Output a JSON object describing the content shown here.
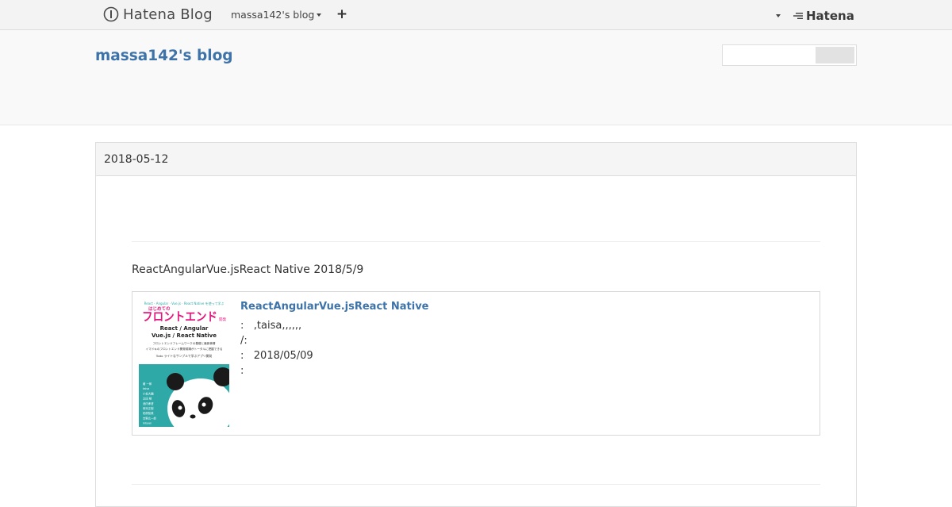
{
  "global_header": {
    "logo_text": "Hatena Blog",
    "blog_menu_label": "massa142's blog",
    "add_button_label": "+",
    "hatena_logo_text": "Hatena"
  },
  "blog_header": {
    "title": "massa142's blog",
    "search": {
      "value": "",
      "placeholder": "",
      "button_label": ""
    }
  },
  "entry": {
    "date": "2018-05-12",
    "text": "ReactAngularVue.jsReact Native 2018/5/9",
    "book": {
      "title": "ReactAngularVue.jsReact Native",
      "author_line": ":   ,taisa,,,,,,",
      "publisher_line": "/:",
      "date_line": ":   2018/05/09",
      "media_line": ":",
      "cover": {
        "top_caption": "React · Angular · Vue.js · React Native を使って学ぶ",
        "small_title": "はじめての",
        "big_title": "フロントエンド",
        "big_title_suffix": "開発",
        "subtitle_line1": "React / Angular",
        "subtitle_line2": "Vue.js / React Native",
        "desc_line1": "フロントエンドフレームワークの基礎と最新事情",
        "desc_line2": "イマドキのフロントエンド開発現場がトータルに把握できる",
        "desc_line3": "Todo ライトなサンプルで学ぶアプリ開発",
        "authors": [
          "著 一郎",
          "taisa",
          "小松大輔",
          "太田 郁",
          "池内孝啓",
          "岡本正樹",
          "柏原智美",
          "吉野広一郎",
          "inkyan"
        ],
        "colors": {
          "background": "#2fa9a8",
          "title_pink": "#e4167d",
          "panda_black": "#1a1a1a"
        }
      }
    }
  },
  "colors": {
    "link_blue": "#3d73a8",
    "topbar_bg": "#f3f3f3",
    "header_bg": "#f9f9f9"
  }
}
